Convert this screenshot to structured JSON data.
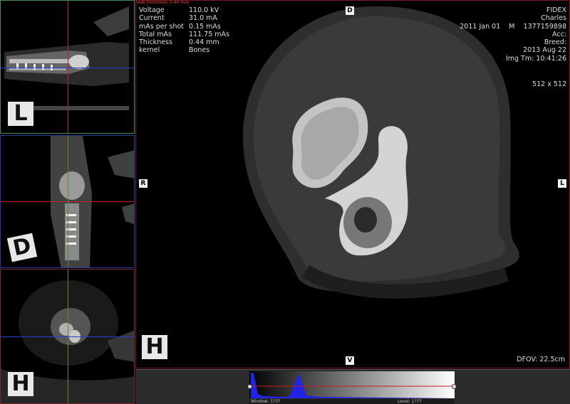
{
  "thumbnails": [
    {
      "orientation_letter": "L",
      "view": "sagittal"
    },
    {
      "orientation_letter": "D",
      "view": "dorsal"
    },
    {
      "orientation_letter": "H",
      "view": "transverse"
    }
  ],
  "main_view": {
    "slab_label": "Slab thickness: 0.44 mm",
    "acquisition": [
      {
        "key": "Voltage",
        "value": "110.0 kV"
      },
      {
        "key": "Current",
        "value": "31.0 mA"
      },
      {
        "key": "mAs per shot",
        "value": "0.15 mAs"
      },
      {
        "key": "Total mAs",
        "value": "111.75 mAs"
      },
      {
        "key": "Thickness",
        "value": "0.44 mm"
      },
      {
        "key": "kernel",
        "value": "Bones"
      }
    ],
    "patient": {
      "institution": "FIDEX",
      "name": "Charles",
      "dob_sex_id": "2011 Jan 01    M    1377159898",
      "acc": "Acc:",
      "breed": "Breed:",
      "study_date": "2013 Aug 22",
      "img_time": "Img Tm: 10:41:26"
    },
    "matrix": "512 x 512",
    "dfov": "DFOV: 22.5cm",
    "orientation_markers": {
      "top": "D",
      "left": "R",
      "right": "L",
      "bottom": "V"
    },
    "main_letter": "H"
  },
  "histogram": {
    "window_label": "Window: 1?3?",
    "level_label": "Level: 1??7"
  },
  "colors": {
    "crosshair_red": "#c41e1e",
    "crosshair_blue": "#2a3fd0",
    "crosshair_green": "#2ca02c",
    "histogram_fill": "#2323e6",
    "panel_border_main": "#7a1a1a"
  }
}
